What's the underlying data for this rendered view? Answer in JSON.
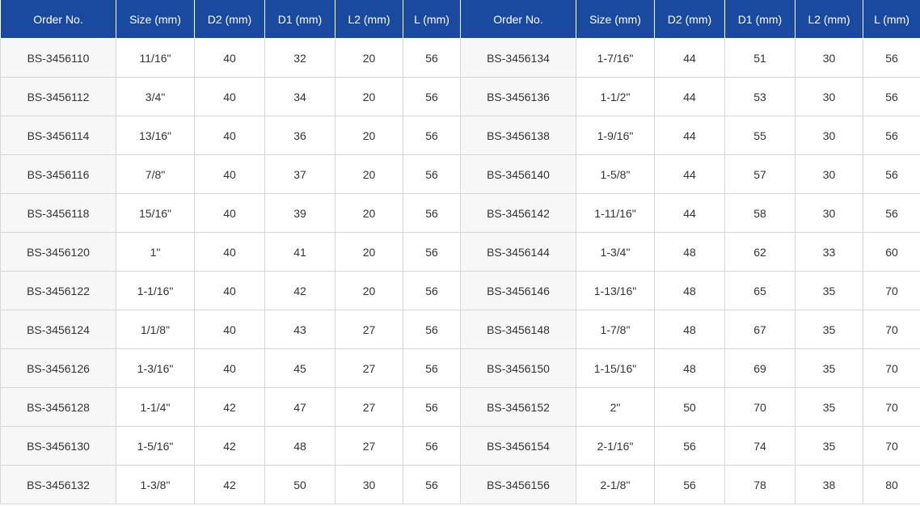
{
  "colors": {
    "header_bg": "#1a4aa0",
    "header_text": "#ffffff",
    "order_cell_bg": "#f7f7f7",
    "border": "#d6d6d6"
  },
  "table": {
    "headers": [
      "Order No.",
      "Size (mm)",
      "D2 (mm)",
      "D1 (mm)",
      "L2 (mm)",
      "L (mm)",
      "Order No.",
      "Size (mm)",
      "D2 (mm)",
      "D1 (mm)",
      "L2 (mm)",
      "L (mm)"
    ],
    "rows": [
      [
        "BS-3456110",
        "11/16\"",
        "40",
        "32",
        "20",
        "56",
        "BS-3456134",
        "1-7/16\"",
        "44",
        "51",
        "30",
        "56"
      ],
      [
        "BS-3456112",
        "3/4\"",
        "40",
        "34",
        "20",
        "56",
        "BS-3456136",
        "1-1/2\"",
        "44",
        "53",
        "30",
        "56"
      ],
      [
        "BS-3456114",
        "13/16\"",
        "40",
        "36",
        "20",
        "56",
        "BS-3456138",
        "1-9/16\"",
        "44",
        "55",
        "30",
        "56"
      ],
      [
        "BS-3456116",
        "7/8\"",
        "40",
        "37",
        "20",
        "56",
        "BS-3456140",
        "1-5/8\"",
        "44",
        "57",
        "30",
        "56"
      ],
      [
        "BS-3456118",
        "15/16\"",
        "40",
        "39",
        "20",
        "56",
        "BS-3456142",
        "1-11/16\"",
        "44",
        "58",
        "30",
        "56"
      ],
      [
        "BS-3456120",
        "1\"",
        "40",
        "41",
        "20",
        "56",
        "BS-3456144",
        "1-3/4\"",
        "48",
        "62",
        "33",
        "60"
      ],
      [
        "BS-3456122",
        "1-1/16\"",
        "40",
        "42",
        "20",
        "56",
        "BS-3456146",
        "1-13/16\"",
        "48",
        "65",
        "35",
        "70"
      ],
      [
        "BS-3456124",
        "1/1/8\"",
        "40",
        "43",
        "27",
        "56",
        "BS-3456148",
        "1-7/8\"",
        "48",
        "67",
        "35",
        "70"
      ],
      [
        "BS-3456126",
        "1-3/16\"",
        "40",
        "45",
        "27",
        "56",
        "BS-3456150",
        "1-15/16\"",
        "48",
        "69",
        "35",
        "70"
      ],
      [
        "BS-3456128",
        "1-1/4\"",
        "42",
        "47",
        "27",
        "56",
        "BS-3456152",
        "2\"",
        "50",
        "70",
        "35",
        "70"
      ],
      [
        "BS-3456130",
        "1-5/16\"",
        "42",
        "48",
        "27",
        "56",
        "BS-3456154",
        "2-1/16\"",
        "56",
        "74",
        "35",
        "70"
      ],
      [
        "BS-3456132",
        "1-3/8\"",
        "42",
        "50",
        "30",
        "56",
        "BS-3456156",
        "2-1/8\"",
        "56",
        "78",
        "38",
        "80"
      ]
    ]
  }
}
